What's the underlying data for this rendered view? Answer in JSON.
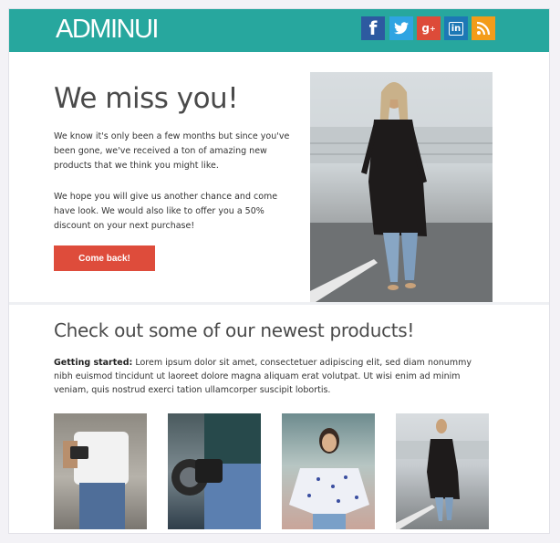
{
  "header": {
    "logo": "ADMINUI",
    "social": [
      {
        "name": "facebook",
        "glyph": "f",
        "color": "#2d5aa0"
      },
      {
        "name": "twitter",
        "glyph": "t",
        "color": "#2fa4e2"
      },
      {
        "name": "google-plus",
        "glyph": "g+",
        "color": "#dd4b39"
      },
      {
        "name": "linkedin",
        "glyph": "in",
        "color": "#1d78b5"
      },
      {
        "name": "rss",
        "glyph": "rss",
        "color": "#f39c19"
      }
    ],
    "background": "#27a79e"
  },
  "hero": {
    "headline": "We miss you!",
    "paragraph_1": "We know it's only been a few months but since you've been gone, we've received a ton of amazing new products that we think you might like.",
    "paragraph_2": "We hope you will give us another chance and come have look. We would also like to offer you a 50% discount on your next purchase!",
    "cta_label": "Come back!",
    "cta_color": "#de4c3b"
  },
  "products": {
    "title": "Check out some of our newest products!",
    "intro_label": "Getting started:",
    "intro_text": " Lorem ipsum dolor sit amet, consectetuer adipiscing elit, sed diam nonummy nibh euismod tincidunt ut laoreet dolore magna aliquam erat volutpat. Ut wisi enim ad minim veniam, quis nostrud exerci tation ullamcorper suscipit lobortis."
  }
}
